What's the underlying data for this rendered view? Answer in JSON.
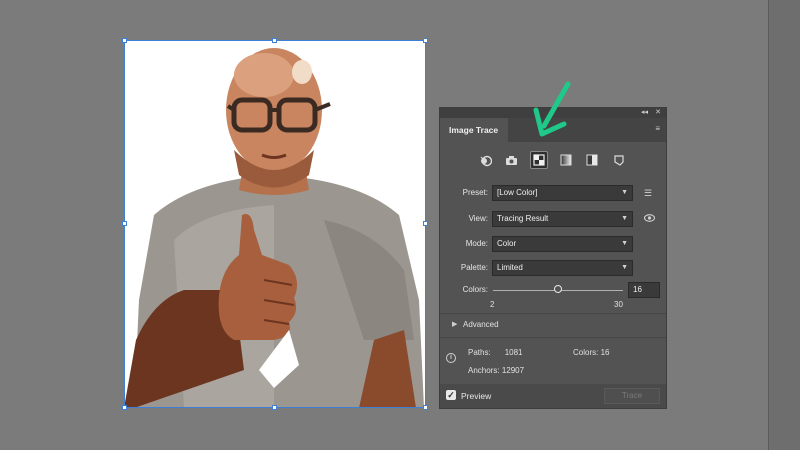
{
  "panel": {
    "tab_title": "Image Trace",
    "collapse_glyph": "◂◂",
    "close_glyph": "✕",
    "menu_glyph": "≡",
    "presets": [
      "auto-color-icon",
      "high-color-icon",
      "low-color-icon",
      "grayscale-icon",
      "black-white-icon",
      "outline-icon"
    ],
    "active_preset": "low-color-icon"
  },
  "fields": {
    "preset_label": "Preset:",
    "preset_value": "[Low Color]",
    "view_label": "View:",
    "view_value": "Tracing Result",
    "mode_label": "Mode:",
    "mode_value": "Color",
    "palette_label": "Palette:",
    "palette_value": "Limited",
    "colors_label": "Colors:",
    "colors_value": "16",
    "colors_min": "2",
    "colors_max": "30",
    "colors_fraction": 0.5
  },
  "advanced": {
    "toggle": "▶",
    "label": "Advanced"
  },
  "stats": {
    "paths_label": "Paths:",
    "paths_value": "1081",
    "colors_label": "Colors:",
    "colors_value": "16",
    "anchors_label": "Anchors:",
    "anchors_value": "12907"
  },
  "footer": {
    "preview_check": "✓",
    "preview_label": "Preview",
    "trace_label": "Trace"
  },
  "colors": {
    "accent_arrow": "#1ec98a",
    "selection": "#3f7fd6",
    "panel_bg": "#535353"
  }
}
